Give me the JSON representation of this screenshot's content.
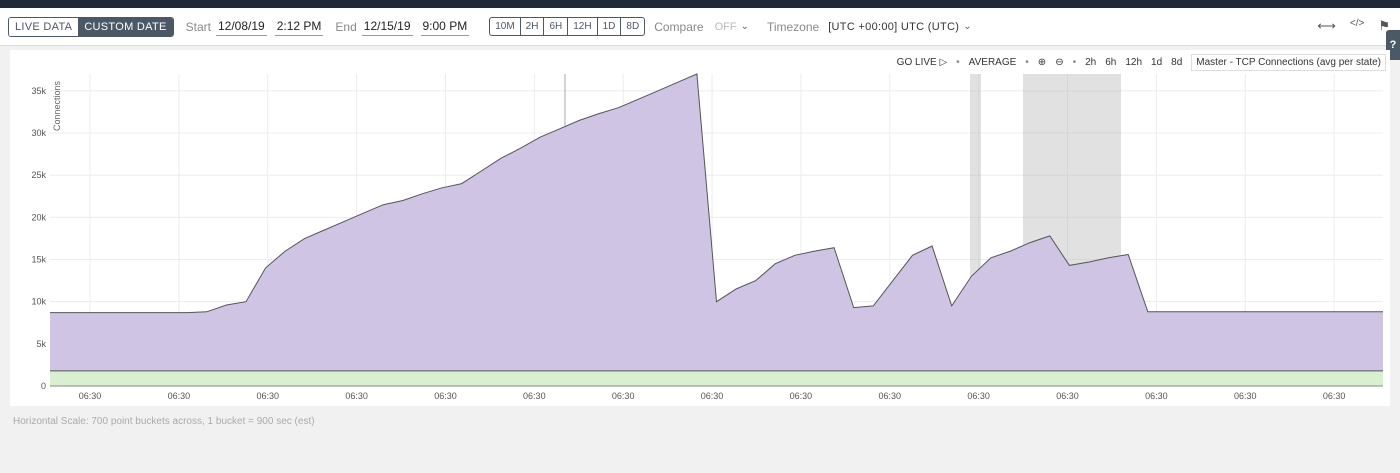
{
  "toolbar": {
    "mode_tabs": [
      "LIVE DATA",
      "CUSTOM DATE"
    ],
    "start_label": "Start",
    "start_date": "12/08/19",
    "start_time": "2:12 PM",
    "end_label": "End",
    "end_date": "12/15/19",
    "end_time": "9:00 PM",
    "ranges": [
      "10M",
      "2H",
      "6H",
      "12H",
      "1D",
      "8D"
    ],
    "compare_label": "Compare",
    "compare_value": "OFF",
    "timezone_label": "Timezone",
    "timezone_value": "[UTC +00:00] UTC (UTC)"
  },
  "chart_header": {
    "go_live": "GO LIVE",
    "aggregate": "AVERAGE",
    "zooms": [
      "2h",
      "6h",
      "12h",
      "1d",
      "8d"
    ],
    "metric": "Master - TCP Connections (avg per state)"
  },
  "footer": "Horizontal Scale: 700 point buckets across, 1 bucket = 900 sec (est)",
  "colors": {
    "area_main": "#d0c4e4",
    "area_base": "#d8f0cf",
    "line": "#555555",
    "accent": "#4b5966"
  },
  "chart_data": {
    "type": "area",
    "ylabel": "Connections",
    "ylim": [
      0,
      37000
    ],
    "yticks": [
      "0",
      "5k",
      "10k",
      "15k",
      "20k",
      "25k",
      "30k",
      "35k"
    ],
    "xticks": [
      "06:30",
      "06:30",
      "06:30",
      "06:30",
      "06:30",
      "06:30",
      "06:30",
      "06:30",
      "06:30",
      "06:30",
      "06:30",
      "06:30",
      "06:30",
      "06:30",
      "06:30"
    ],
    "series": [
      {
        "values": [
          8700,
          8700,
          8700,
          8700,
          8700,
          8700,
          8700,
          8700,
          8800,
          9600,
          10000,
          14000,
          16000,
          17500,
          18500,
          19500,
          20500,
          21500,
          22000,
          22800,
          23500,
          24000,
          25500,
          27000,
          28200,
          29500,
          30500,
          31500,
          32300,
          33000,
          34000,
          35000,
          36000,
          37000,
          10000,
          11500,
          12500,
          14500,
          15500,
          16000,
          16400,
          9300,
          9500,
          12500,
          15500,
          16600,
          9500,
          13000,
          15200,
          16000,
          17000,
          17800,
          14300,
          14700,
          15200,
          15600,
          8800,
          8800,
          8800,
          8800,
          8800,
          8800,
          8800,
          8800,
          8800,
          8800,
          8800,
          8800,
          8800
        ]
      },
      {
        "values": [
          1800
        ]
      }
    ]
  }
}
